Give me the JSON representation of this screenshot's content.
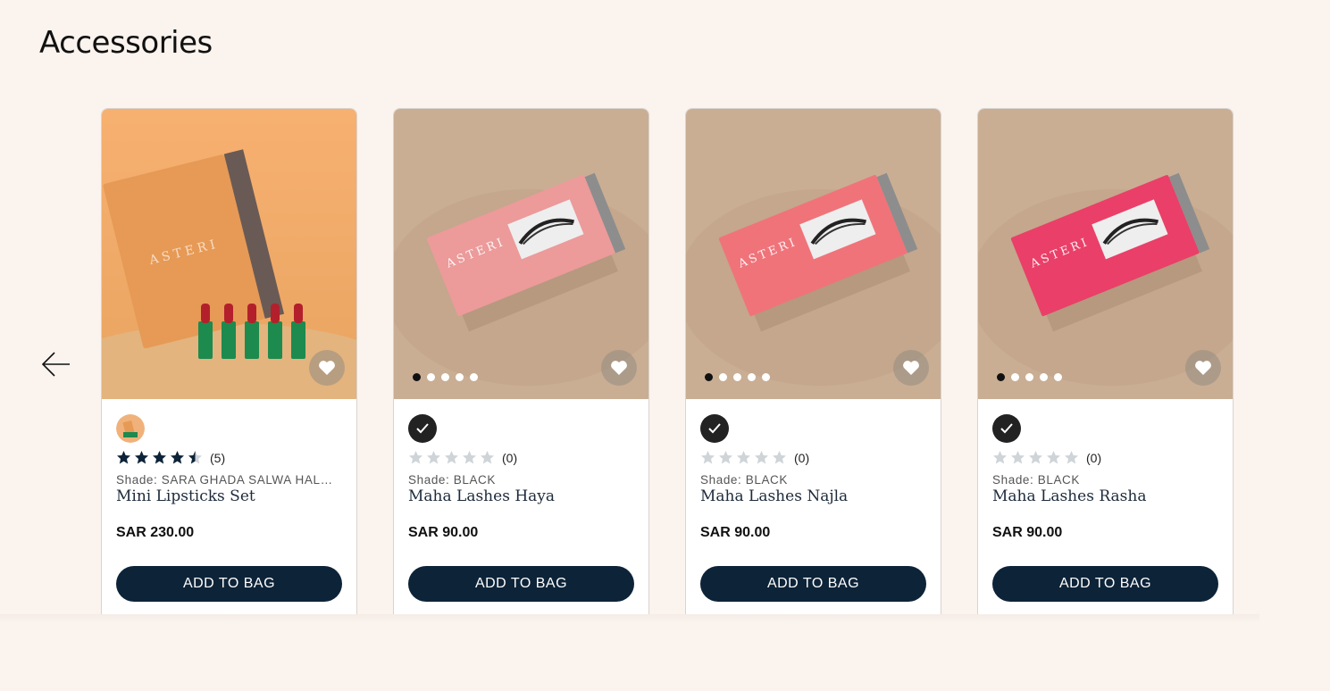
{
  "section": {
    "title": "Accessories"
  },
  "colors": {
    "accent": "#0d2338",
    "background": "#faf3ee",
    "star_filled": "#0d2338",
    "star_empty": "#cfd4d8"
  },
  "products": [
    {
      "name": "Mini Lipsticks Set",
      "shade": "Shade: SARA GHADA SALWA HALA…",
      "price": "SAR 230.00",
      "rating": 4.5,
      "rating_count": "(5)",
      "cta": "ADD TO BAG",
      "image_brand": "ASTERI",
      "image_variant": "lipsticks",
      "box_color": "#e69a55",
      "swatch": "thumbnail"
    },
    {
      "name": "Maha Lashes Haya",
      "shade": "Shade: BLACK",
      "price": "SAR 90.00",
      "rating": 0,
      "rating_count": "(0)",
      "cta": "ADD TO BAG",
      "image_brand": "ASTERI",
      "image_variant": "lashes",
      "box_color": "#ec9a9a",
      "swatch": "check"
    },
    {
      "name": "Maha Lashes Najla",
      "shade": "Shade: BLACK",
      "price": "SAR 90.00",
      "rating": 0,
      "rating_count": "(0)",
      "cta": "ADD TO BAG",
      "image_brand": "ASTERI",
      "image_variant": "lashes",
      "box_color": "#f0737a",
      "swatch": "check"
    },
    {
      "name": "Maha Lashes Rasha",
      "shade": "Shade: BLACK",
      "price": "SAR 90.00",
      "rating": 0,
      "rating_count": "(0)",
      "cta": "ADD TO BAG",
      "image_brand": "ASTERI",
      "image_variant": "lashes",
      "box_color": "#ea3f68",
      "swatch": "check"
    }
  ]
}
